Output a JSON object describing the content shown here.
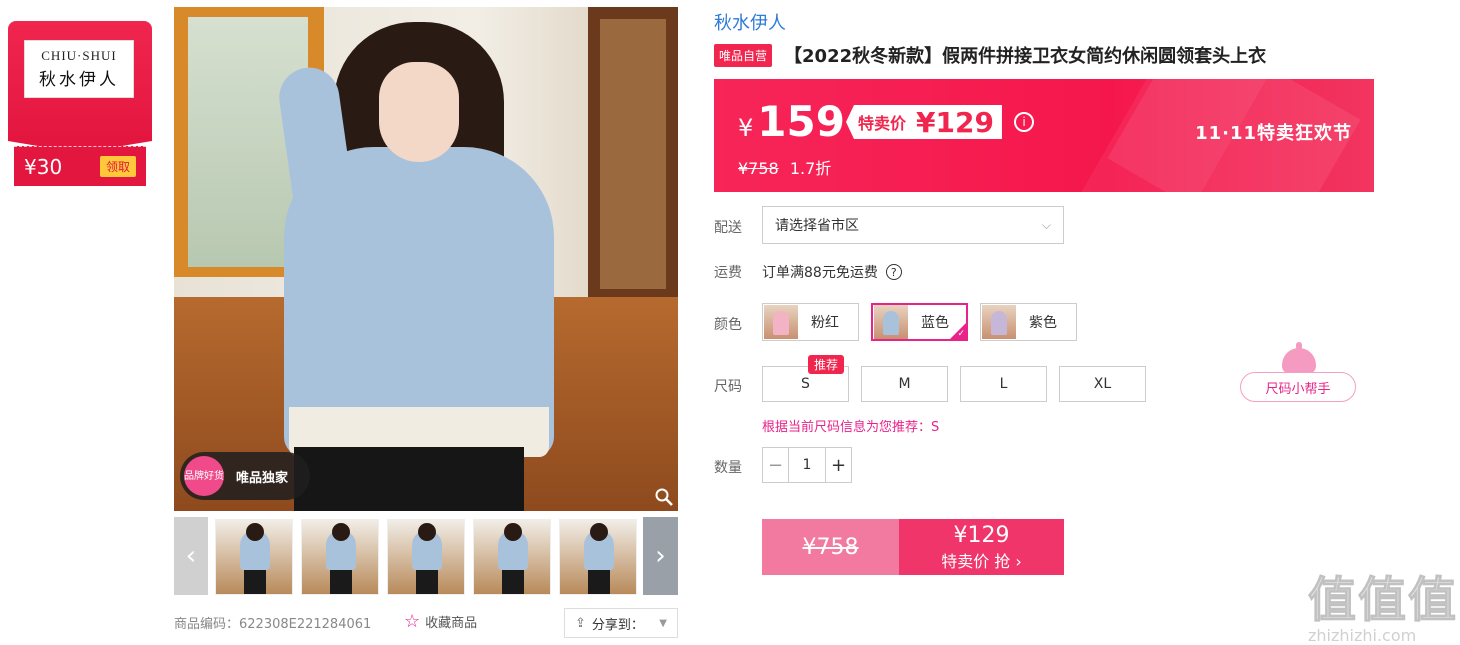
{
  "brand_card": {
    "logo_en": "CHIU·SHUI",
    "logo_cn": "秋水伊人",
    "coupon_amount": "¥30",
    "coupon_button": "领取"
  },
  "gallery": {
    "badge_circle": "品牌好货",
    "badge_text": "唯品独家",
    "product_code": "商品编码：622308E221284061",
    "favorite": "收藏商品",
    "share": "分享到："
  },
  "product": {
    "brand": "秋水伊人",
    "self_tag": "唯品自营",
    "title": "【2022秋冬新款】假两件拼接卫衣女简约休闲圆领套头上衣"
  },
  "price": {
    "yen": "¥",
    "price": "159",
    "special_label": "特卖价",
    "special_value": "¥129",
    "orig": "¥758",
    "discount": "1.7折",
    "festival": "11·11特卖狂欢节"
  },
  "delivery": {
    "label": "配送",
    "placeholder": "请选择省市区"
  },
  "shipping": {
    "label": "运费",
    "text": "订单满88元免运费"
  },
  "color": {
    "label": "颜色",
    "options": [
      {
        "name": "粉红"
      },
      {
        "name": "蓝色"
      },
      {
        "name": "紫色"
      }
    ],
    "swatches": [
      "#f4b3c4",
      "#a9c2dc",
      "#c6b7d8"
    ]
  },
  "size": {
    "label": "尺码",
    "options": [
      "S",
      "M",
      "L",
      "XL"
    ],
    "rec_tag": "推荐",
    "helper": "尺码小帮手",
    "rec_text": "根据当前尺码信息为您推荐：S"
  },
  "quantity": {
    "label": "数量",
    "minus": "−",
    "value": "1",
    "plus": "+"
  },
  "buy": {
    "orig": "¥758",
    "price": "¥129",
    "action": "特卖价 抢 ›"
  },
  "watermark": {
    "big": "值值值",
    "small": "zhizhizhi.com"
  },
  "colors": {
    "accent": "#f0264f",
    "pink": "#e8238a",
    "link": "#2f7bd8"
  }
}
